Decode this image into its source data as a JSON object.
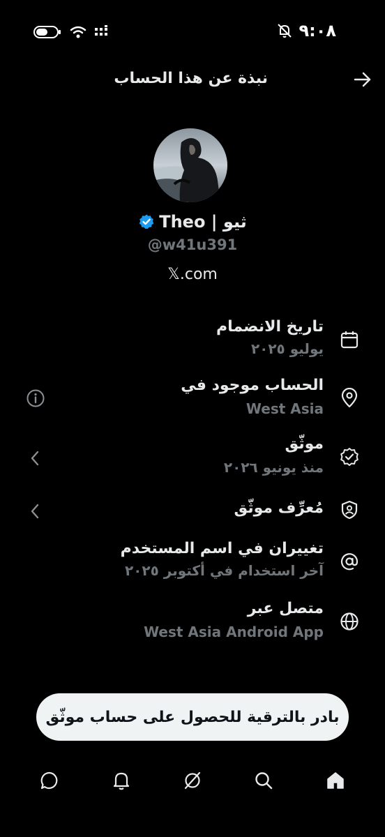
{
  "status_bar": {
    "time": "٩:٠٨"
  },
  "header": {
    "title": "نبذة عن هذا الحساب"
  },
  "profile": {
    "display_name": "ثيو | Theo",
    "handle": "@w41u391",
    "site": "𝕏.com",
    "accent": "#1d9bf0"
  },
  "rows": [
    {
      "title": "تاريخ الانضمام",
      "subtitle": "يوليو ٢٠٢٥",
      "icon": "calendar-icon"
    },
    {
      "title": "الحساب موجود في",
      "subtitle": "West Asia",
      "icon": "location-pin-icon"
    },
    {
      "title": "موثّق",
      "subtitle": "منذ يونيو ٢٠٢٦",
      "icon": "verified-badge-icon"
    },
    {
      "title": "مُعرِّف موثّق",
      "subtitle": "",
      "icon": "shield-person-icon"
    },
    {
      "title": "تغييران في اسم المستخدم",
      "subtitle": "آخر استخدام في أكتوبر ٢٠٢٥",
      "icon": "at-sign-icon"
    },
    {
      "title": "متصل عبر",
      "subtitle": "West Asia Android App",
      "icon": "globe-icon"
    }
  ],
  "upgrade_button": {
    "label": "بادر بالترقية للحصول على حساب موثّق"
  },
  "bottom_nav": [
    "home-icon",
    "search-icon",
    "grok-icon",
    "notifications-icon",
    "messages-icon"
  ]
}
